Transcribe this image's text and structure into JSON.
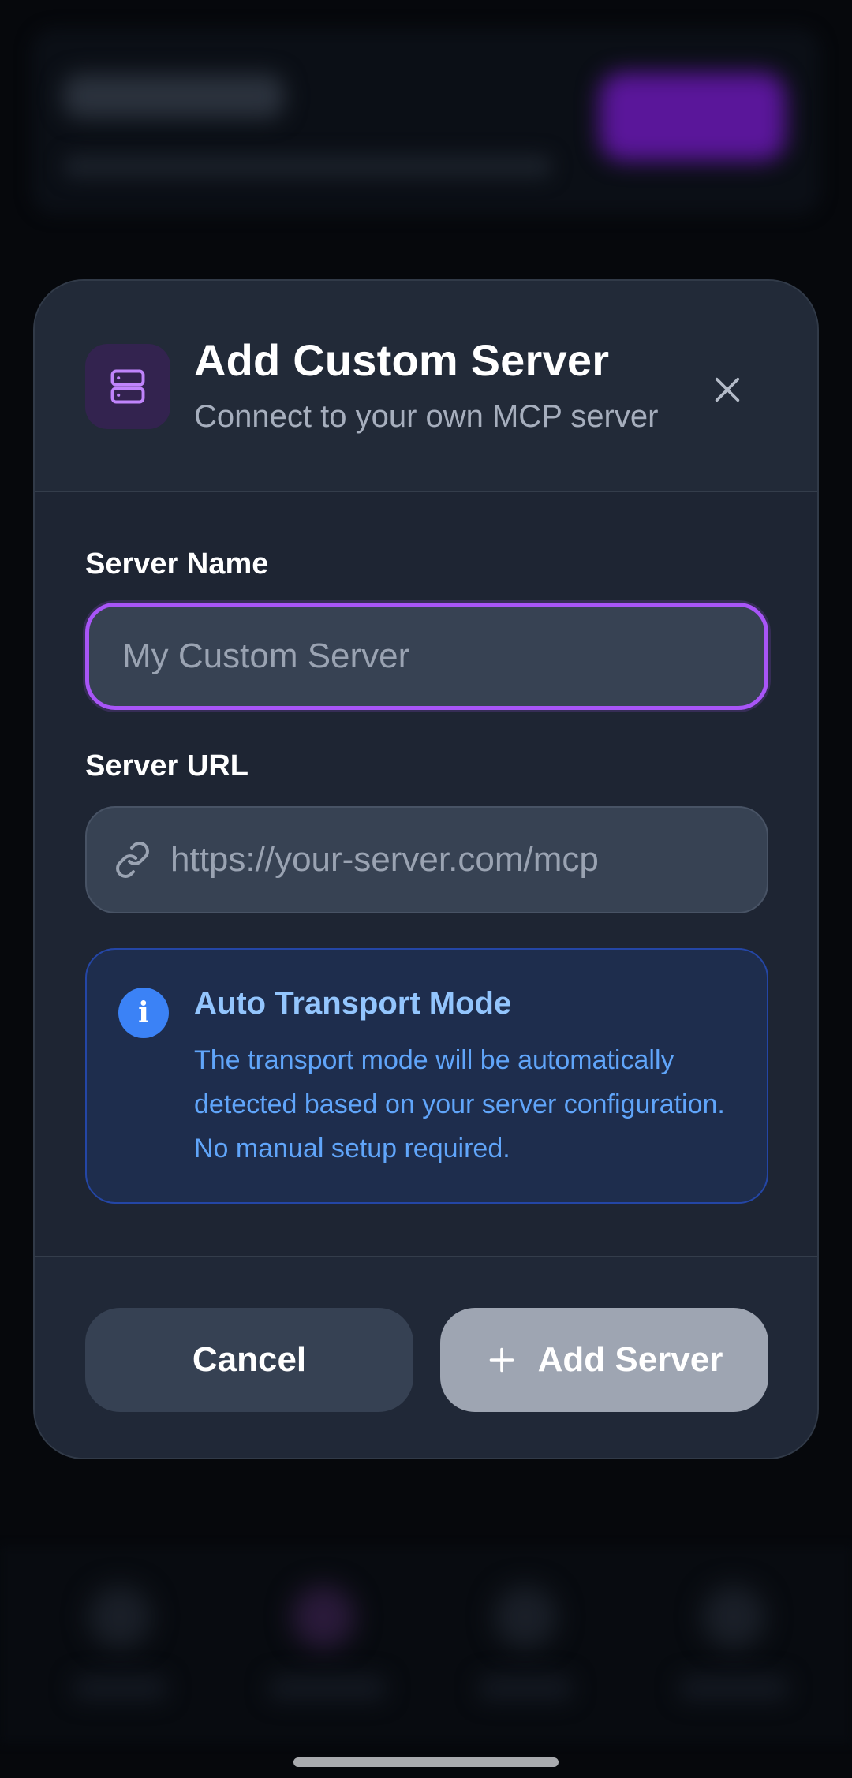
{
  "modal": {
    "title": "Add Custom Server",
    "subtitle": "Connect to your own MCP server",
    "header_icon": "server-icon",
    "close_icon": "close-icon"
  },
  "form": {
    "server_name": {
      "label": "Server Name",
      "placeholder": "My Custom Server",
      "value": ""
    },
    "server_url": {
      "label": "Server URL",
      "placeholder": "https://your-server.com/mcp",
      "value": "",
      "icon": "link-icon"
    }
  },
  "info": {
    "icon_glyph": "i",
    "title": "Auto Transport Mode",
    "body": "The transport mode will be automatically detected based on your server configuration. No manual setup required."
  },
  "footer": {
    "cancel_label": "Cancel",
    "add_label": "Add Server",
    "add_icon": "plus-icon"
  },
  "colors": {
    "accent_purple": "#a855f7",
    "info_blue": "#3b82f6",
    "modal_bg": "#1e2533",
    "add_button_disabled": "#9ea5b2"
  }
}
